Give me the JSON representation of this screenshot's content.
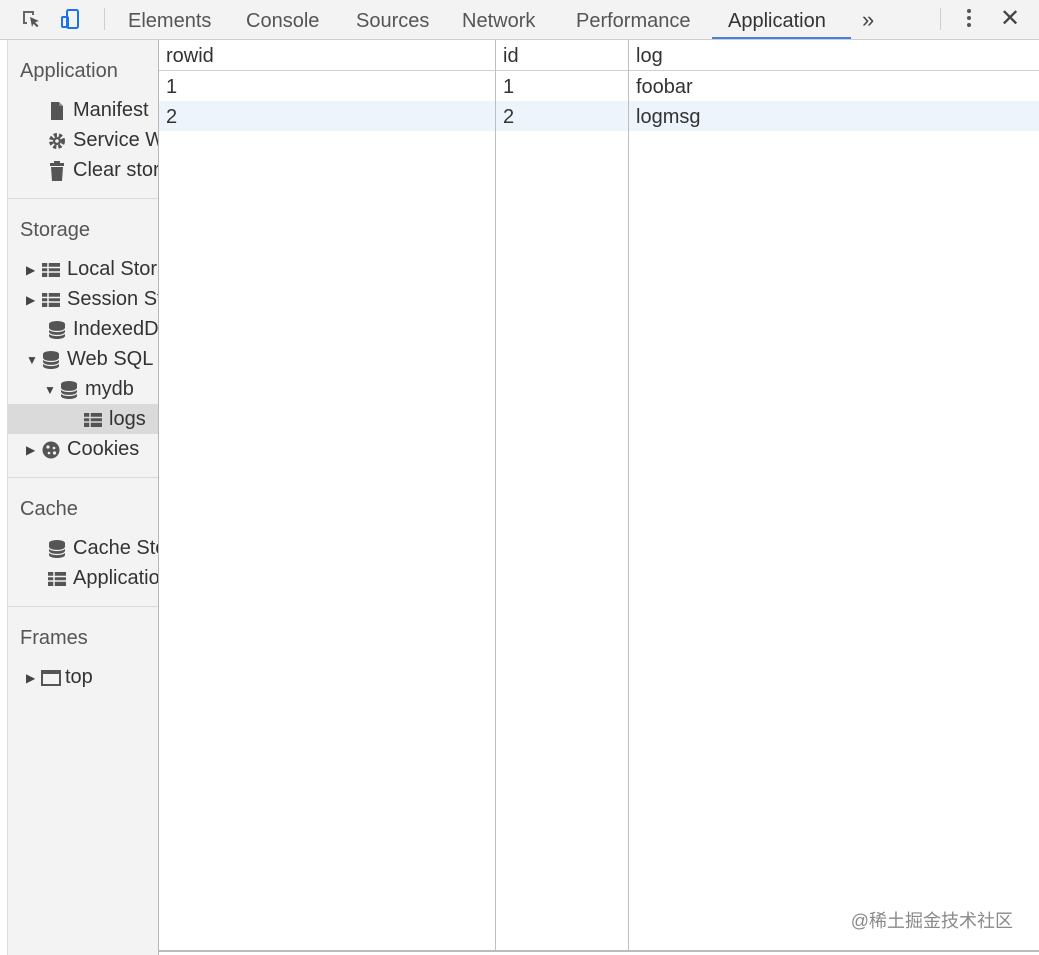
{
  "toolbar": {
    "tabs": [
      "Elements",
      "Console",
      "Sources",
      "Network",
      "Performance",
      "Application"
    ],
    "more": "»",
    "close": "✕"
  },
  "sidebar": {
    "application": {
      "title": "Application",
      "items": [
        "Manifest",
        "Service Workers",
        "Clear storage"
      ]
    },
    "storage": {
      "title": "Storage",
      "items": [
        "Local Storage",
        "Session Storage",
        "IndexedDB",
        "Web SQL",
        "mydb",
        "logs",
        "Cookies"
      ]
    },
    "cache": {
      "title": "Cache",
      "items": [
        "Cache Storage",
        "Application Cache"
      ]
    },
    "frames": {
      "title": "Frames",
      "items": [
        "top"
      ]
    }
  },
  "table": {
    "columns": [
      "rowid",
      "id",
      "log"
    ],
    "rows": [
      [
        "1",
        "1",
        "foobar"
      ],
      [
        "2",
        "2",
        "logmsg"
      ]
    ]
  },
  "watermark": "@稀土掘金技术社区",
  "colors": {
    "accent": "#4a7fe0",
    "selected_row": "#eef4fb",
    "selected_item": "#dadada"
  }
}
